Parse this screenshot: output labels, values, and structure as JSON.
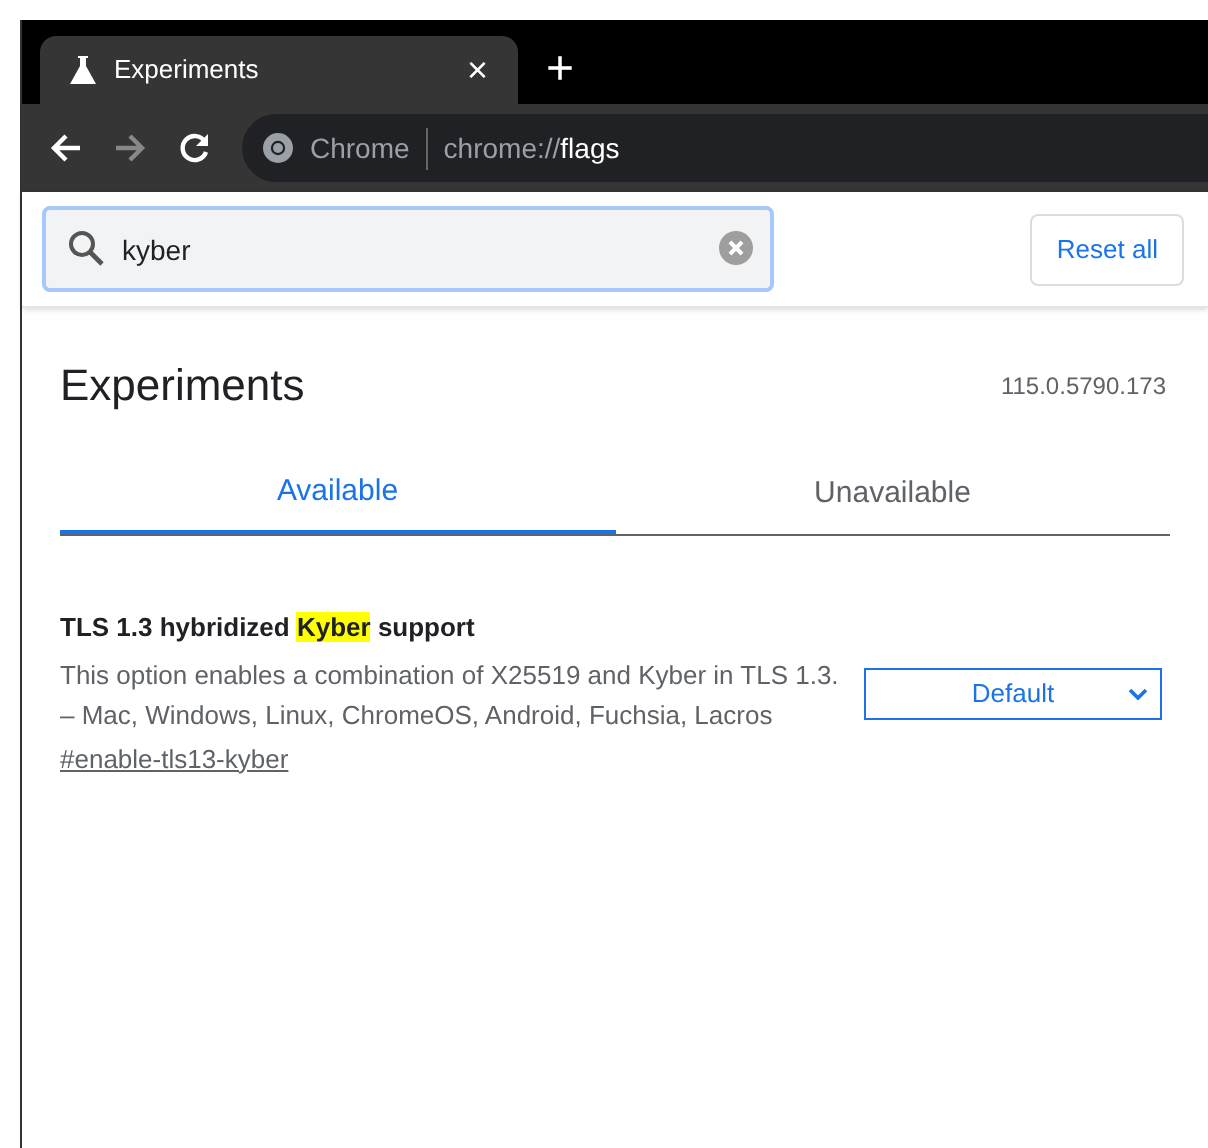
{
  "tab": {
    "title": "Experiments",
    "close": "×"
  },
  "new_tab": "+",
  "address_bar": {
    "site": "Chrome",
    "url_prefix": "chrome://",
    "url_path": "flags"
  },
  "search": {
    "value": "kyber"
  },
  "reset_button": "Reset all",
  "heading": "Experiments",
  "version": "115.0.5790.173",
  "tabs": [
    {
      "label": "Available",
      "selected": true
    },
    {
      "label": "Unavailable",
      "selected": false
    }
  ],
  "experiments": [
    {
      "title": [
        {
          "text": "TLS 1.3 hybridized ",
          "highlighted": false
        },
        {
          "text": "Kyber",
          "highlighted": true
        },
        {
          "text": " support",
          "highlighted": false
        }
      ],
      "description": "This option enables a combination of X25519 and Kyber in TLS 1.3. – Mac, Windows, Linux, ChromeOS, Android, Fuchsia, Lacros",
      "link": "#enable-tls13-kyber",
      "value": "Default"
    }
  ]
}
